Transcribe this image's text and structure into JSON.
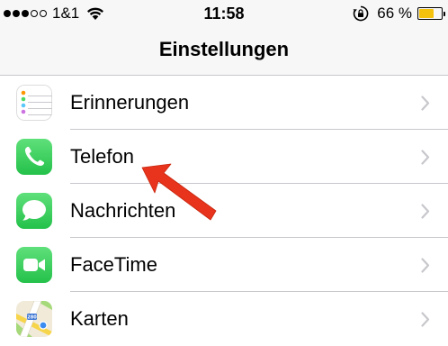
{
  "status_bar": {
    "signal_dots_filled": 3,
    "signal_dots_total": 5,
    "carrier": "1&1",
    "time": "11:58",
    "battery_percent_label": "66 %",
    "battery_level": 0.66,
    "battery_color": "#f4c20d"
  },
  "nav": {
    "title": "Einstellungen"
  },
  "settings": {
    "items": [
      {
        "label": "Erinnerungen",
        "icon": "reminders-icon"
      },
      {
        "label": "Telefon",
        "icon": "phone-icon"
      },
      {
        "label": "Nachrichten",
        "icon": "messages-icon"
      },
      {
        "label": "FaceTime",
        "icon": "facetime-icon"
      },
      {
        "label": "Karten",
        "icon": "maps-icon"
      }
    ]
  },
  "colors": {
    "green": "#34c759",
    "annotation_red": "#e8341c",
    "separator": "#c8c7cc",
    "chevron": "#c7c7cc"
  },
  "annotation": {
    "type": "arrow",
    "points_to": "Telefon"
  }
}
